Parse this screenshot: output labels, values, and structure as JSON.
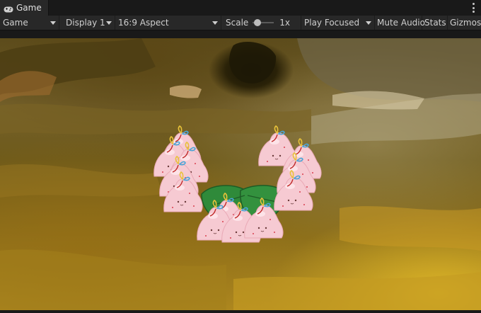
{
  "tab": {
    "label": "Game"
  },
  "toolbar": {
    "game_view_label": "Game",
    "display_label": "Display 1",
    "aspect_label": "16:9 Aspect",
    "scale_label": "Scale",
    "scale_value": "1x",
    "scale_fraction": 0.1,
    "play_mode_label": "Play Focused",
    "mute_label": "Mute Audio",
    "stats_label": "Stats",
    "gizmos_label": "Gizmos"
  },
  "colors": {
    "editor_bg": "#191919",
    "toolbar_bg": "#282828",
    "text": "#d2d2d2",
    "slime_pink": "#f4c7cf",
    "leaf_green": "#2f8a3a"
  },
  "icons": [
    "gamepad-icon",
    "kebab-menu-icon",
    "dropdown-arrow-icon"
  ]
}
